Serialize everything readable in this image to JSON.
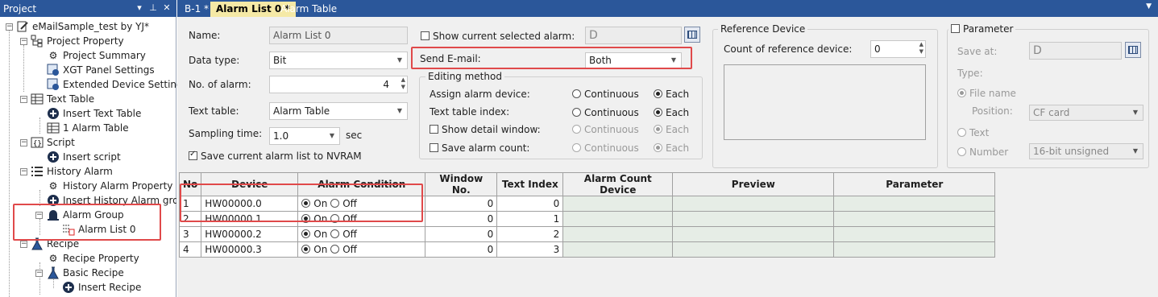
{
  "project": {
    "title": "Project",
    "root": "eMailSample_test by YJ*",
    "items": [
      {
        "label": "Project Property",
        "icon": "project-property-icon"
      },
      {
        "label": "Project Summary",
        "icon": "gear-icon"
      },
      {
        "label": "XGT Panel Settings",
        "icon": "panel-settings-icon"
      },
      {
        "label": "Extended Device Settings",
        "icon": "device-settings-icon"
      },
      {
        "label": "Text Table",
        "icon": "table-icon"
      },
      {
        "label": "Insert Text Table",
        "icon": "plus-circle-icon"
      },
      {
        "label": "1 Alarm Table",
        "icon": "table-icon"
      },
      {
        "label": "Script",
        "icon": "script-icon"
      },
      {
        "label": "Insert script",
        "icon": "plus-circle-icon"
      },
      {
        "label": "History Alarm",
        "icon": "list-icon"
      },
      {
        "label": "History Alarm Property",
        "icon": "gear-icon"
      },
      {
        "label": "Insert History Alarm group",
        "icon": "plus-circle-icon"
      },
      {
        "label": "Alarm Group",
        "icon": "bell-icon"
      },
      {
        "label": "Alarm List 0",
        "icon": "alarm-list-icon"
      },
      {
        "label": "Recipe",
        "icon": "flask-icon"
      },
      {
        "label": "Recipe Property",
        "icon": "gear-icon"
      },
      {
        "label": "Basic Recipe",
        "icon": "flask-icon"
      },
      {
        "label": "Insert Recipe",
        "icon": "plus-circle-icon"
      }
    ]
  },
  "tabs": [
    "B-1 *",
    "Alarm List 0 *",
    "Alarm Table"
  ],
  "form": {
    "name_label": "Name:",
    "name_value": "Alarm List 0",
    "datatype_label": "Data type:",
    "datatype_value": "Bit",
    "num_alarm_label": "No. of alarm:",
    "num_alarm_value": "4",
    "text_table_label": "Text table:",
    "text_table_value": "Alarm Table",
    "sampling_label": "Sampling time:",
    "sampling_value": "1.0",
    "sampling_unit": "sec",
    "nvram_label": "Save current alarm list to NVRAM",
    "show_current_label": "Show current selected alarm:",
    "show_current_value": "D",
    "send_email_label": "Send E-mail:",
    "send_email_value": "Both"
  },
  "editing": {
    "title": "Editing method",
    "rows": [
      {
        "label": "Assign alarm device:",
        "opt1": "Continuous",
        "opt2": "Each"
      },
      {
        "label": "Text table index:",
        "opt1": "Continuous",
        "opt2": "Each"
      },
      {
        "label": "Show detail window:",
        "opt1": "Continuous",
        "opt2": "Each"
      },
      {
        "label": "Save alarm count:",
        "opt1": "Continuous",
        "opt2": "Each"
      }
    ]
  },
  "reference": {
    "title": "Reference Device",
    "count_label": "Count of reference device:",
    "count_value": "0"
  },
  "parameter": {
    "title": "Parameter",
    "save_at_label": "Save at:",
    "save_at_value": "D",
    "type_label": "Type:",
    "file_name_label": "File name",
    "position_label": "Position:",
    "position_value": "CF card",
    "text_label": "Text",
    "number_label": "Number",
    "number_value": "16-bit unsigned"
  },
  "table": {
    "headers": [
      "No",
      "Device",
      "Alarm Condition",
      "Window No.",
      "Text Index",
      "Alarm Count Device",
      "Preview",
      "Parameter"
    ],
    "on_label": "On",
    "off_label": "Off",
    "rows": [
      {
        "no": "1",
        "device": "HW00000.0",
        "window": "0",
        "index": "0"
      },
      {
        "no": "2",
        "device": "HW00000.1",
        "window": "0",
        "index": "1"
      },
      {
        "no": "3",
        "device": "HW00000.2",
        "window": "0",
        "index": "2"
      },
      {
        "no": "4",
        "device": "HW00000.3",
        "window": "0",
        "index": "3"
      }
    ]
  },
  "colors": {
    "titlebar": "#2b579a",
    "highlight": "#e0494a",
    "active_tab": "#f5e9a6"
  }
}
